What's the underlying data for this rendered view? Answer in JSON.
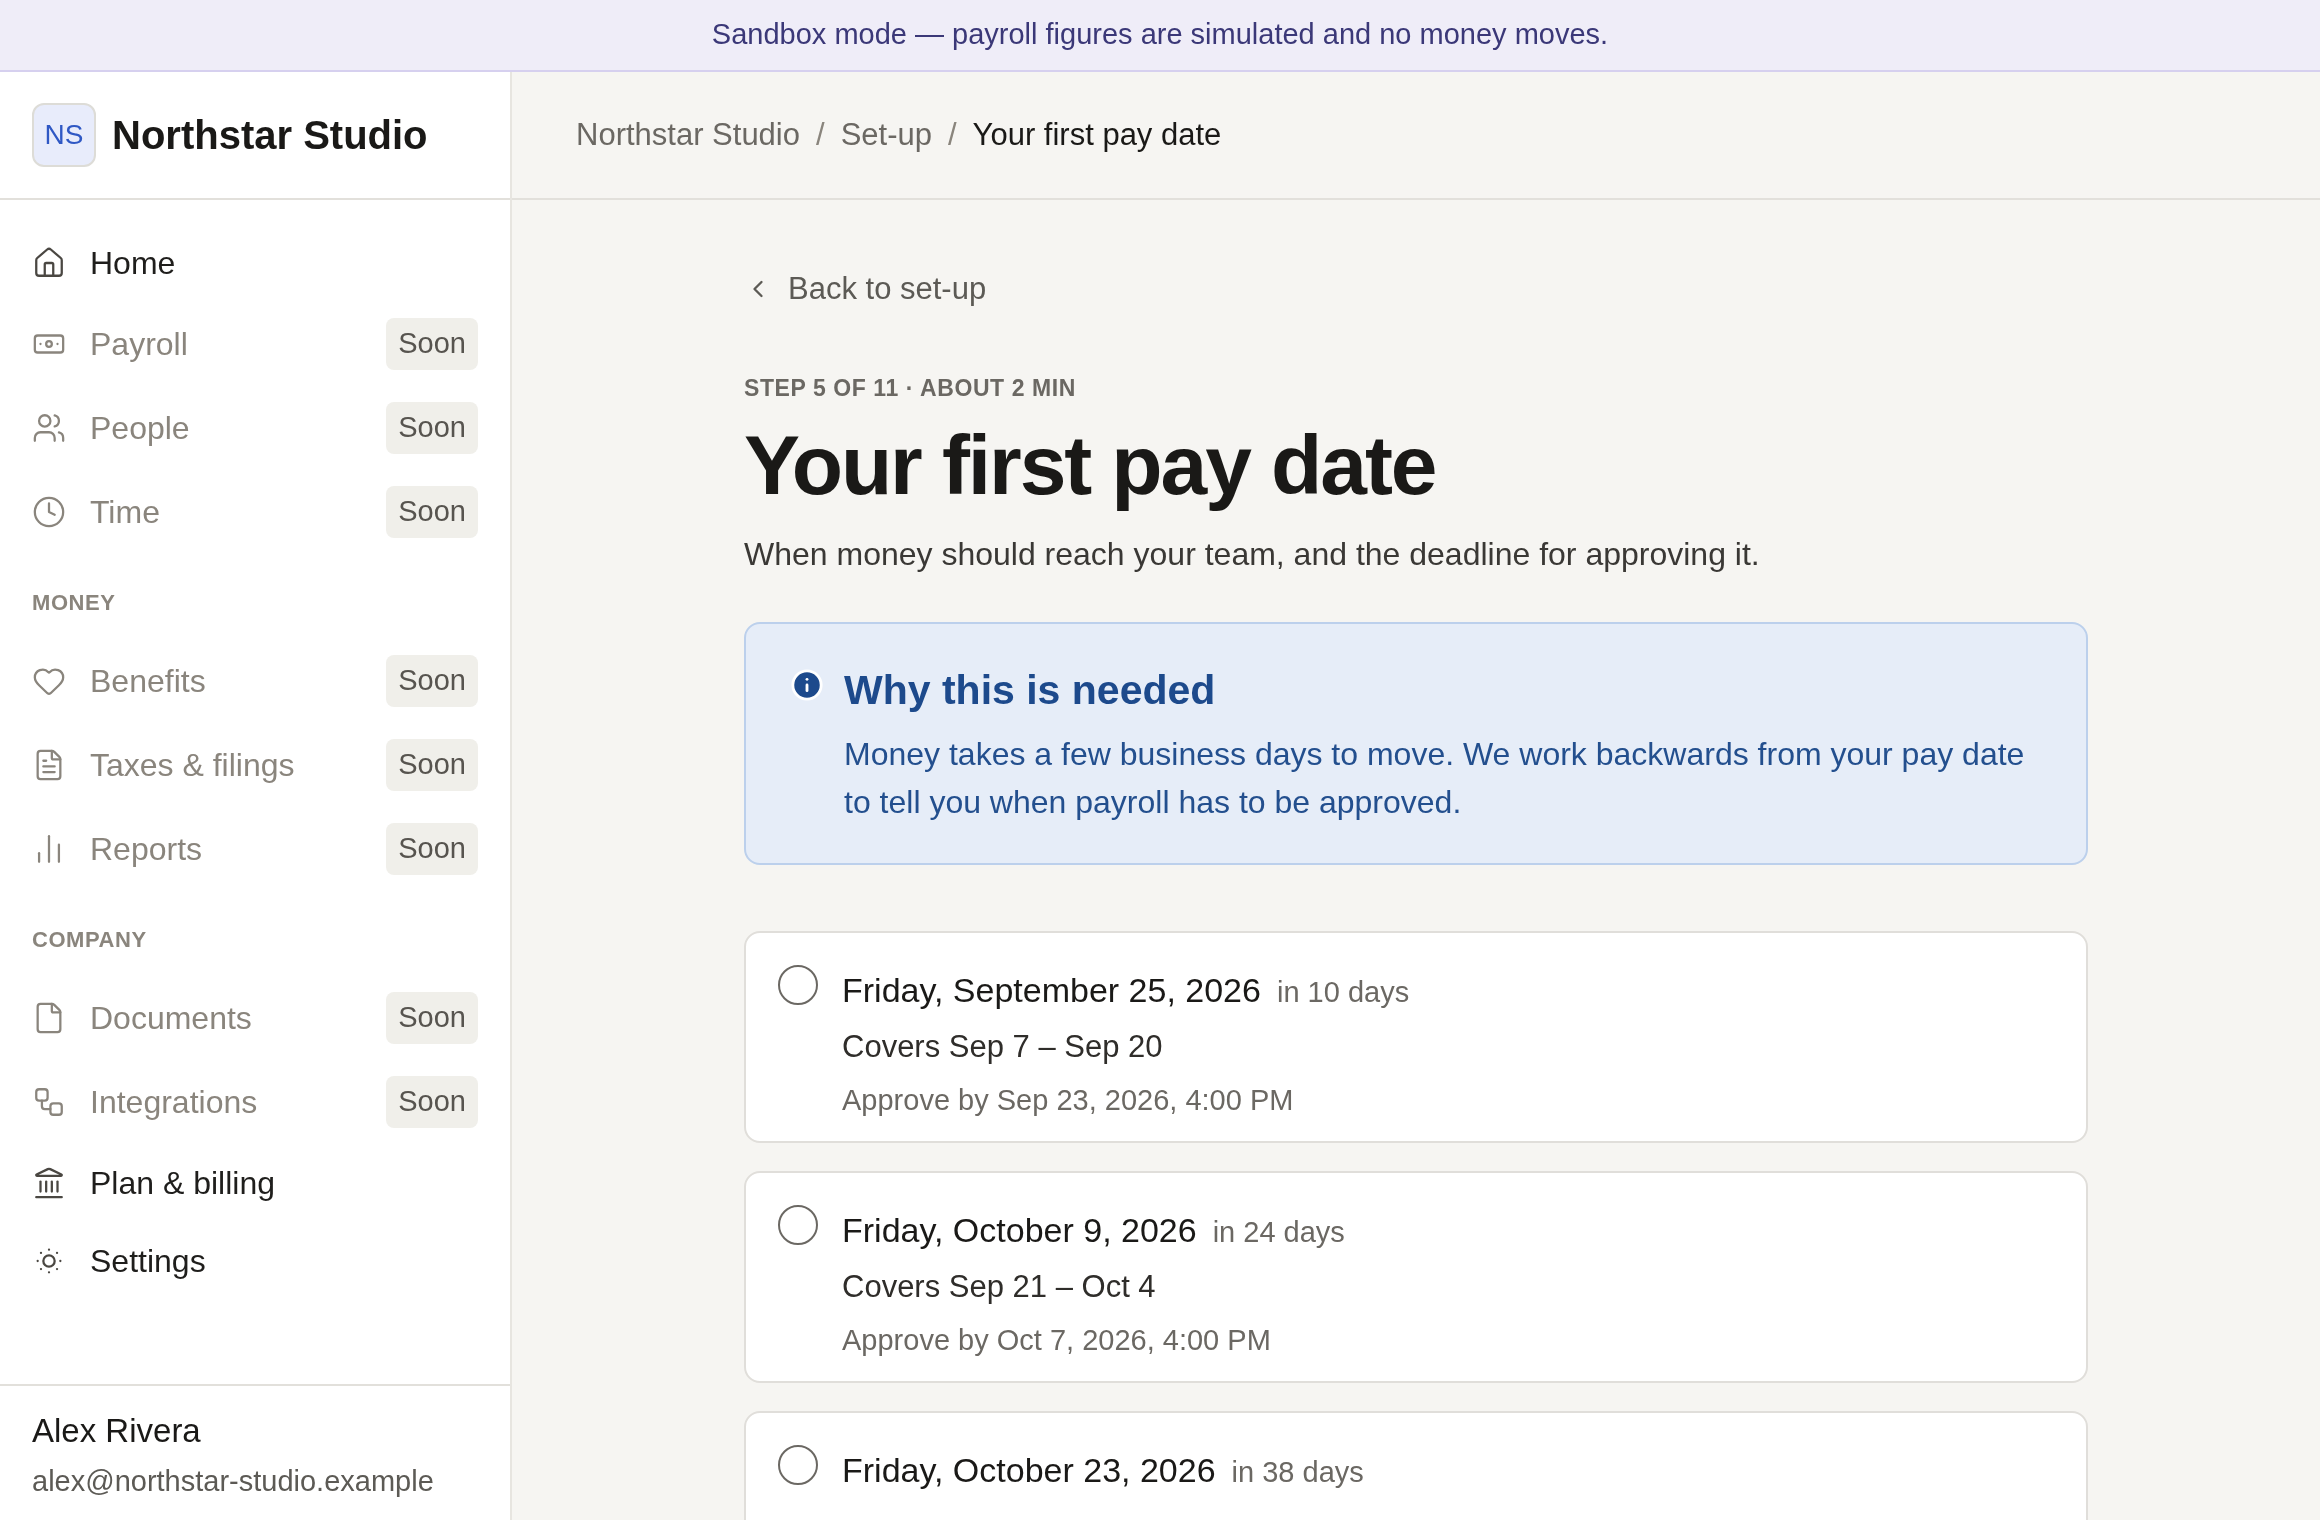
{
  "banner": {
    "text": "Sandbox mode — payroll figures are simulated and no money moves."
  },
  "sidebar": {
    "brand": {
      "initials": "NS",
      "name": "Northstar Studio"
    },
    "sections": [
      {
        "items": [
          {
            "label": "Home",
            "disabled": false
          },
          {
            "label": "Payroll",
            "disabled": true,
            "badge": "Soon"
          },
          {
            "label": "People",
            "disabled": true,
            "badge": "Soon"
          },
          {
            "label": "Time",
            "disabled": true,
            "badge": "Soon"
          }
        ]
      },
      {
        "heading": "MONEY",
        "items": [
          {
            "label": "Benefits",
            "disabled": true,
            "badge": "Soon"
          },
          {
            "label": "Taxes & filings",
            "disabled": true,
            "badge": "Soon"
          },
          {
            "label": "Reports",
            "disabled": true,
            "badge": "Soon"
          }
        ]
      },
      {
        "heading": "COMPANY",
        "items": [
          {
            "label": "Documents",
            "disabled": true,
            "badge": "Soon"
          },
          {
            "label": "Integrations",
            "disabled": true,
            "badge": "Soon"
          },
          {
            "label": "Plan & billing",
            "disabled": false
          },
          {
            "label": "Settings",
            "disabled": false
          }
        ]
      }
    ],
    "user": {
      "name": "Alex Rivera",
      "email": "alex@northstar-studio.example"
    }
  },
  "breadcrumbs": {
    "separator": "/",
    "items": [
      {
        "label": "Northstar Studio",
        "current": false
      },
      {
        "label": "Set-up",
        "current": false
      },
      {
        "label": "Your first pay date",
        "current": true
      }
    ]
  },
  "back_link": "Back to set-up",
  "step_label": "STEP 5 OF 11 · ABOUT 2 MIN",
  "title": "Your first pay date",
  "subtitle": "When money should reach your team, and the deadline for approving it.",
  "info": {
    "heading": "Why this is needed",
    "body": "Money takes a few business days to move. We work backwards from your pay date to tell you when payroll has to be approved."
  },
  "pay_dates": [
    {
      "date": "Friday, September 25, 2026",
      "relative": "in 10 days",
      "covers": "Covers Sep 7 – Sep 20",
      "approve_by": "Approve by Sep 23, 2026, 4:00 PM",
      "selected": false
    },
    {
      "date": "Friday, October 9, 2026",
      "relative": "in 24 days",
      "covers": "Covers Sep 21 – Oct 4",
      "approve_by": "Approve by Oct 7, 2026, 4:00 PM",
      "selected": false
    },
    {
      "date": "Friday, October 23, 2026",
      "relative": "in 38 days",
      "selected": false
    }
  ]
}
